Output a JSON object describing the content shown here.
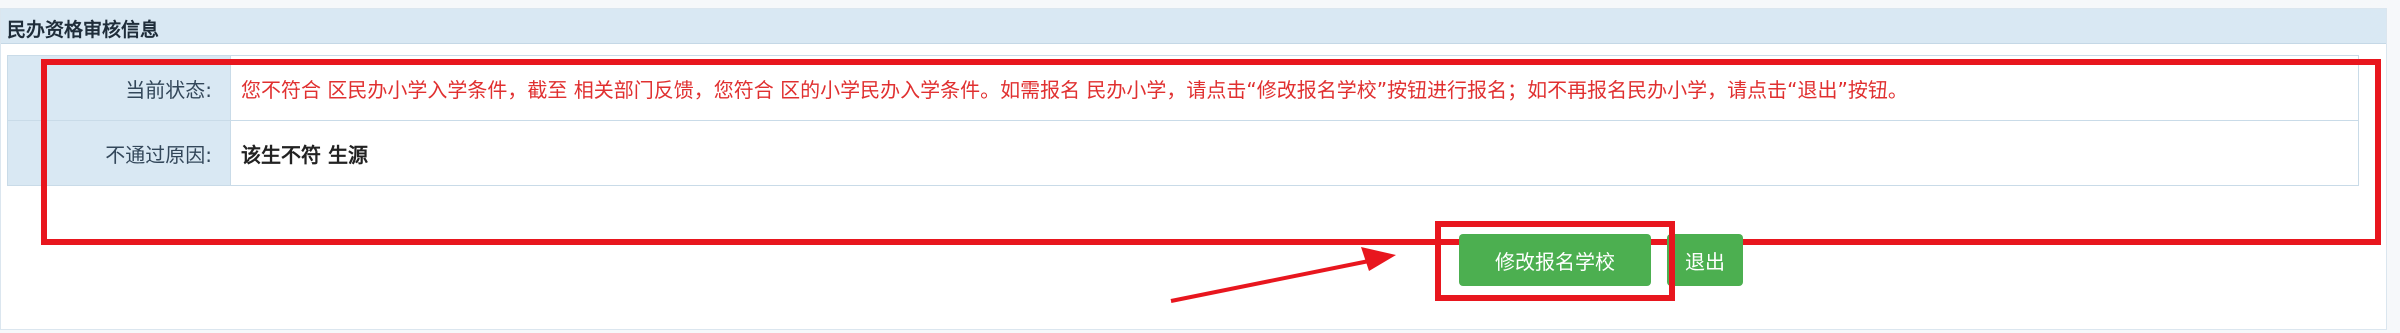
{
  "section": {
    "title": "民办资格审核信息"
  },
  "rows": [
    {
      "label": "当前状态:",
      "value": "您不符合 区民办小学入学条件，截至 相关部门反馈，您符合 区的小学民办入学条件。如需报名 民办小学，请点击“修改报名学校”按钮进行报名；如不再报名民办小学，请点击“退出”按钮。"
    },
    {
      "label": "不通过原因:",
      "value": "该生不符 生源"
    }
  ],
  "buttons": {
    "modify": "修改报名学校",
    "exit": "退出"
  },
  "colors": {
    "annotation_red": "#e8161e",
    "button_green": "#4caf50",
    "header_blue": "#d9e8f3",
    "status_red": "#e03030"
  }
}
